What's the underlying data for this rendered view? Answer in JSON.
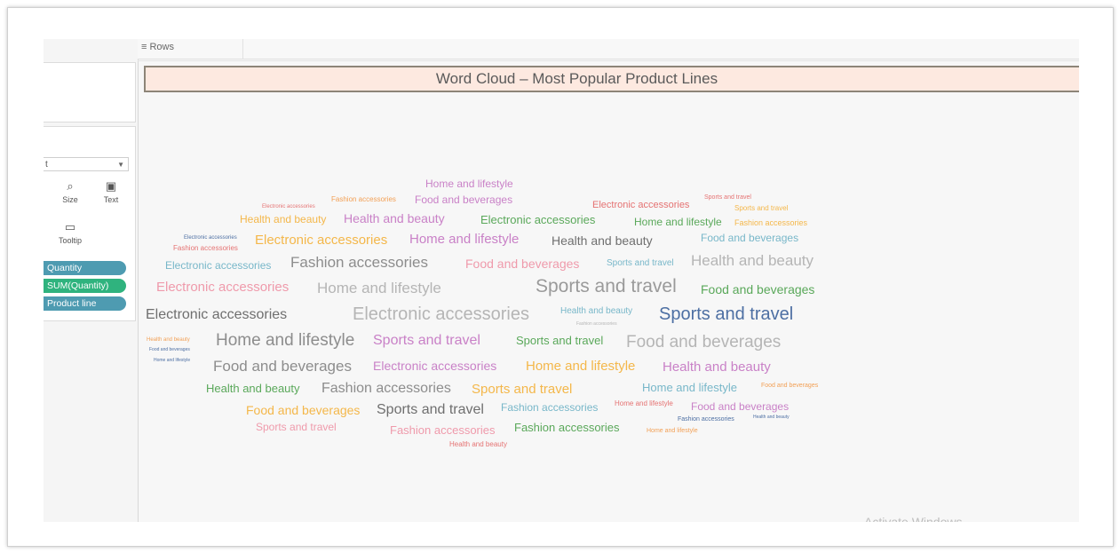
{
  "rows_shelf": {
    "label": "Rows"
  },
  "sheet": {
    "title": "Word Cloud – Most Popular Product Lines"
  },
  "marks_card": {
    "type_value": "t",
    "buttons": [
      {
        "label": "Size",
        "icon": "size-icon"
      },
      {
        "label": "Text",
        "icon": "text-icon"
      },
      {
        "label": "Tooltip",
        "icon": "tooltip-icon"
      }
    ],
    "pills": [
      {
        "label": "Quantity",
        "color": "#4e9bb1"
      },
      {
        "label": "SUM(Quantity)",
        "color": "#2fb37e"
      },
      {
        "label": "Product line",
        "color": "#4e9bb1"
      }
    ]
  },
  "categories": {
    "Home and lifestyle": "#c981c7",
    "Food and beverages": "#78b7c9",
    "Fashion accessories": "#8d8d8d",
    "Sports and travel": "#ef9aab",
    "Electronic accessories": "#e57373",
    "Health and beauty": "#f4b74a",
    "Electronic accessories 2": "#5aa85a"
  },
  "word_cloud": [
    {
      "text": "Home and lifestyle",
      "color": "#c981c7"
    },
    {
      "text": "Electronic accessories",
      "color": "#e57373"
    },
    {
      "text": "Fashion accessories",
      "color": "#f2a056"
    },
    {
      "text": "Food and beverages",
      "color": "#c981c7"
    },
    {
      "text": "Electronic accessories",
      "color": "#e57373"
    },
    {
      "text": "Sports and travel",
      "color": "#e57373"
    },
    {
      "text": "Sports and travel",
      "color": "#f4b74a"
    },
    {
      "text": "Health and beauty",
      "color": "#f4b74a"
    },
    {
      "text": "Health and beauty",
      "color": "#c981c7"
    },
    {
      "text": "Electronic accessories",
      "color": "#5aa85a"
    },
    {
      "text": "Home and lifestyle",
      "color": "#5aa85a"
    },
    {
      "text": "Fashion accessories",
      "color": "#f4b74a"
    },
    {
      "text": "Electronic accessories",
      "color": "#4d6fa3"
    },
    {
      "text": "Electronic accessories",
      "color": "#f4b74a"
    },
    {
      "text": "Home and lifestyle",
      "color": "#c981c7"
    },
    {
      "text": "Health and beauty",
      "color": "#6f6f6f"
    },
    {
      "text": "Food and beverages",
      "color": "#78b7c9"
    },
    {
      "text": "Fashion accessories",
      "color": "#e57373"
    },
    {
      "text": "Electronic accessories",
      "color": "#78b7c9"
    },
    {
      "text": "Fashion accessories",
      "color": "#8d8d8d"
    },
    {
      "text": "Food and beverages",
      "color": "#ef9aab"
    },
    {
      "text": "Sports and travel",
      "color": "#78b7c9"
    },
    {
      "text": "Health and beauty",
      "color": "#b5b5b5"
    },
    {
      "text": "Electronic accessories",
      "color": "#ef9aab"
    },
    {
      "text": "Home and lifestyle",
      "color": "#b5b5b5"
    },
    {
      "text": "Sports and travel",
      "color": "#9a9a9a"
    },
    {
      "text": "Food and beverages",
      "color": "#5aa85a"
    },
    {
      "text": "Electronic accessories",
      "color": "#6f6f6f"
    },
    {
      "text": "Electronic accessories",
      "color": "#b5b5b5"
    },
    {
      "text": "Health and beauty",
      "color": "#78b7c9"
    },
    {
      "text": "Fashion accessories",
      "color": "#b5b5b5"
    },
    {
      "text": "Sports and travel",
      "color": "#4d6fa3"
    },
    {
      "text": "Health and beauty",
      "color": "#f2a056"
    },
    {
      "text": "Home and lifestyle",
      "color": "#8d8d8d"
    },
    {
      "text": "Sports and travel",
      "color": "#c981c7"
    },
    {
      "text": "Sports and travel",
      "color": "#5aa85a"
    },
    {
      "text": "Food and beverages",
      "color": "#b5b5b5"
    },
    {
      "text": "Food and beverages",
      "color": "#4d6fa3"
    },
    {
      "text": "Home and lifestyle",
      "color": "#4d6fa3"
    },
    {
      "text": "Food and beverages",
      "color": "#8d8d8d"
    },
    {
      "text": "Electronic accessories",
      "color": "#c981c7"
    },
    {
      "text": "Home and lifestyle",
      "color": "#f4b74a"
    },
    {
      "text": "Health and beauty",
      "color": "#c981c7"
    },
    {
      "text": "Health and beauty",
      "color": "#5aa85a"
    },
    {
      "text": "Fashion accessories",
      "color": "#8d8d8d"
    },
    {
      "text": "Sports and travel",
      "color": "#f4b74a"
    },
    {
      "text": "Home and lifestyle",
      "color": "#78b7c9"
    },
    {
      "text": "Food and beverages",
      "color": "#f2a056"
    },
    {
      "text": "Food and beverages",
      "color": "#f4b74a"
    },
    {
      "text": "Sports and travel",
      "color": "#6f6f6f"
    },
    {
      "text": "Fashion accessories",
      "color": "#78b7c9"
    },
    {
      "text": "Home and lifestyle",
      "color": "#e57373"
    },
    {
      "text": "Food and beverages",
      "color": "#c981c7"
    },
    {
      "text": "Fashion accessories",
      "color": "#4d6fa3"
    },
    {
      "text": "Health and beauty",
      "color": "#4d6fa3"
    },
    {
      "text": "Sports and travel",
      "color": "#ef9aab"
    },
    {
      "text": "Fashion accessories",
      "color": "#ef9aab"
    },
    {
      "text": "Fashion accessories",
      "color": "#5aa85a"
    },
    {
      "text": "Home and lifestyle",
      "color": "#f2a056"
    },
    {
      "text": "Health and beauty",
      "color": "#e57373"
    }
  ],
  "watermark": "Activate Windows"
}
